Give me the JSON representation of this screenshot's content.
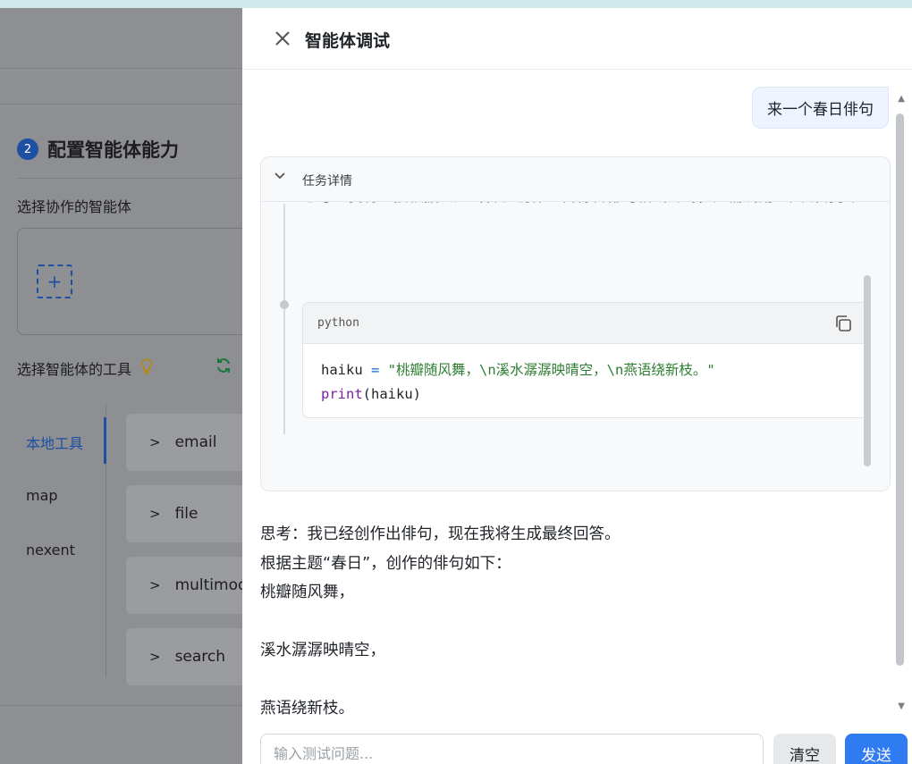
{
  "background": {
    "step_number": "2",
    "step_title": "配置智能体能力",
    "collab_label": "选择协作的智能体",
    "add_icon": "plus-icon",
    "tools_label": "选择智能体的工具",
    "categories": [
      {
        "label": "本地工具",
        "active": true
      },
      {
        "label": "map",
        "active": false
      },
      {
        "label": "nexent",
        "active": false
      }
    ],
    "tools": [
      {
        "label": "email"
      },
      {
        "label": "file"
      },
      {
        "label": "multimod"
      },
      {
        "label": "search"
      }
    ]
  },
  "drawer": {
    "title": "智能体调试",
    "close_icon": "close-icon"
  },
  "chat": {
    "user_message": "来一个春日俳句",
    "task": {
      "title": "任务详情",
      "thought": "思考：我将直接根据主题“春日”创作一首符合俳句格式的诗，无需调用工具或助手。",
      "code_lang": "python",
      "code_line1_var": "haiku",
      "code_line1_op": " = ",
      "code_line1_str": "\"桃瓣随风舞，\\n溪水潺潺映晴空，\\n燕语绕新枝。\"",
      "code_line2_fn": "print",
      "code_line2_rest": "(haiku)"
    },
    "answer_lines": [
      "思考：我已经创作出俳句，现在我将生成最终回答。",
      "根据主题“春日”，创作的俳句如下：",
      "桃瓣随风舞，",
      "",
      "溪水潺潺映晴空，",
      "",
      "燕语绕新枝。"
    ]
  },
  "input": {
    "placeholder": "输入测试问题...",
    "value": "",
    "clear_label": "清空",
    "send_label": "发送"
  },
  "colors": {
    "accent": "#2f7bf2",
    "user_bubble": "#eef4ff",
    "code_string": "#2e7d32",
    "code_function": "#7b1fa2",
    "code_operator": "#0b6bcb"
  }
}
